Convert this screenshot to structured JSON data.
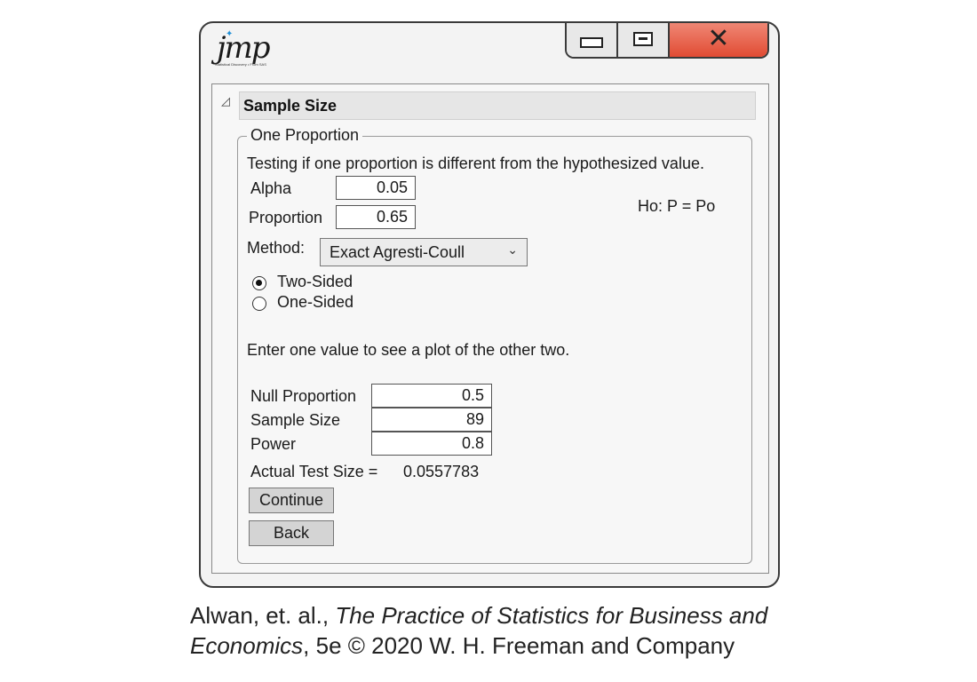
{
  "window": {
    "logo_text": "jmp",
    "logo_subtitle": "Statistical Discovery • From SAS",
    "buttons": {
      "minimize": "minimize-icon",
      "maximize": "maximize-icon",
      "close": "close-icon"
    }
  },
  "section": {
    "arrow": "◿",
    "title": "Sample Size"
  },
  "group": {
    "legend": "One Proportion",
    "description": "Testing if one proportion is different from the hypothesized value.",
    "alpha_label": "Alpha",
    "alpha_value": "0.05",
    "proportion_label": "Proportion",
    "proportion_value": "0.65",
    "hypothesis": "Ho: P = Po",
    "method_label": "Method:",
    "method_value": "Exact Agresti-Coull",
    "radio_two_sided": "Two-Sided",
    "radio_one_sided": "One-Sided",
    "instruction": "Enter one value to see a plot of the other two.",
    "null_prop_label": "Null Proportion",
    "null_prop_value": "0.5",
    "sample_size_label": "Sample Size",
    "sample_size_value": "89",
    "power_label": "Power",
    "power_value": "0.8",
    "actual_test_size_label": "Actual Test Size =",
    "actual_test_size_value": "0.0557783",
    "continue_label": "Continue",
    "back_label": "Back"
  },
  "caption": {
    "authors": "Alwan, et. al., ",
    "book_title_1": "The Practice of Statistics for Business and",
    "book_title_2": "Economics",
    "rest": ", 5e © 2020 W. H. Freeman and Company"
  }
}
